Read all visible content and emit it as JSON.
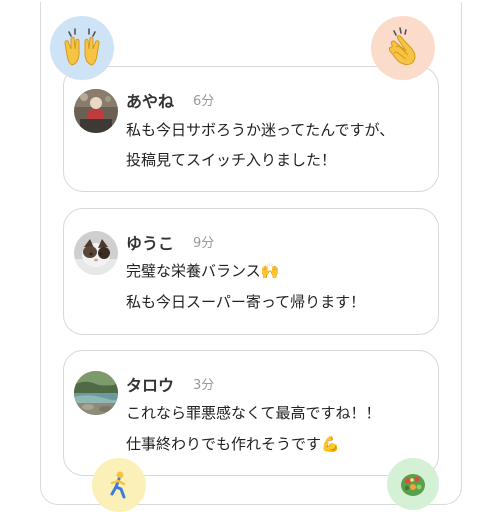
{
  "comments": [
    {
      "name": "あやね",
      "time": "6分",
      "lines": [
        "私も今日サボろうか迷ってたんですが、",
        "投稿見てスイッチ入りました！"
      ]
    },
    {
      "name": "ゆうこ",
      "time": "9分",
      "lines": [
        "完璧な栄養バランス🙌",
        " 私も今日スーパー寄って帰ります！"
      ]
    },
    {
      "name": "タロウ",
      "time": "3分",
      "lines": [
        "これなら罪悪感なくて最高ですね！！",
        "仕事終わりでも作れそうです💪"
      ]
    }
  ],
  "reactions": {
    "top_left": "raising-hands-icon",
    "top_right": "clapping-hands-icon",
    "bottom_left": "running-person-icon",
    "bottom_right": "salad-bowl-icon"
  },
  "colors": {
    "bubble_blue": "#cfe3f7",
    "bubble_peach": "#fbdccb",
    "bubble_yellow": "#fbf1b8",
    "bubble_green": "#d4f1d6",
    "card_border": "#d8d8d8",
    "name_text": "#333333",
    "time_text": "#999999"
  }
}
